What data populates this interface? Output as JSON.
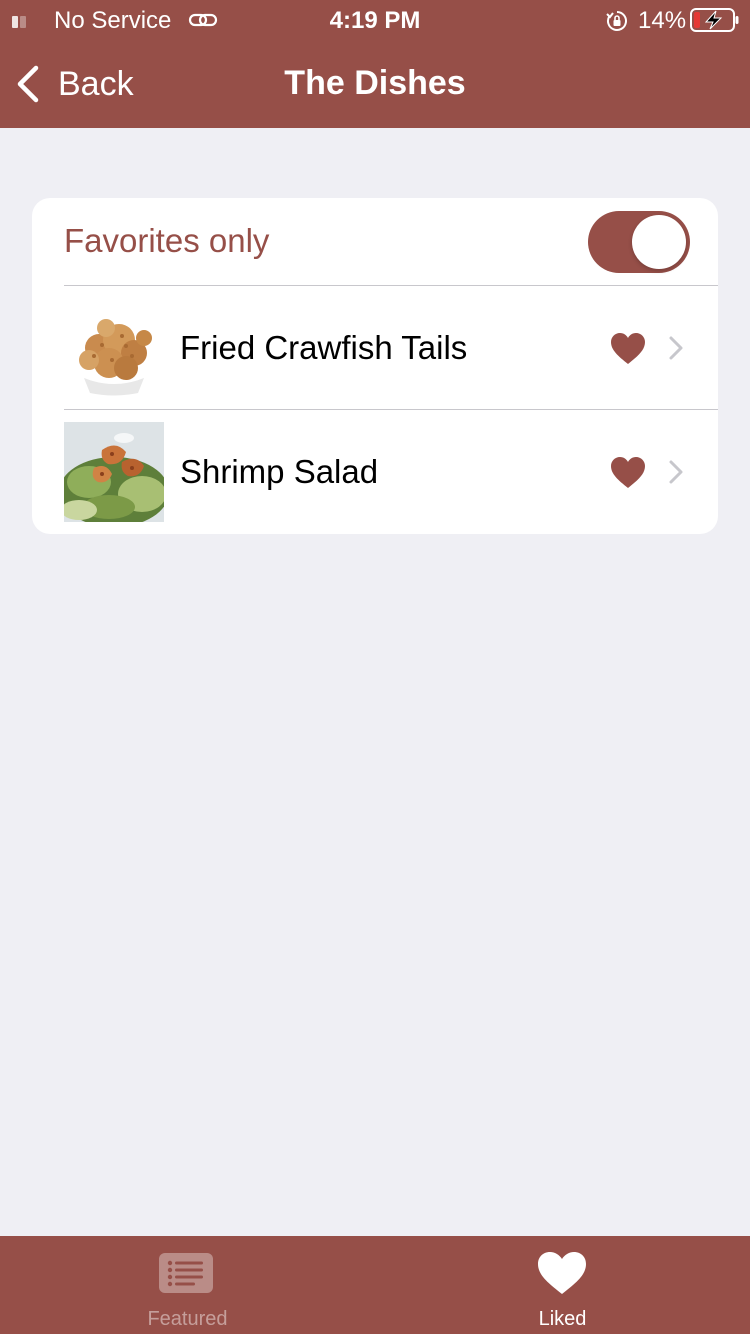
{
  "status_bar": {
    "carrier": "No Service",
    "time": "4:19 PM",
    "battery": "14%",
    "icons": [
      "signal-icon",
      "link-icon",
      "orientation-lock-icon",
      "battery-charging-icon"
    ]
  },
  "nav": {
    "back_label": "Back",
    "title": "The Dishes"
  },
  "filter": {
    "label": "Favorites only",
    "enabled": true
  },
  "dishes": [
    {
      "name": "Fried Crawfish Tails",
      "liked": true
    },
    {
      "name": "Shrimp Salad",
      "liked": true
    }
  ],
  "tabs": [
    {
      "label": "Featured",
      "icon": "list-icon",
      "selected": false
    },
    {
      "label": "Liked",
      "icon": "heart-icon",
      "selected": true
    }
  ],
  "colors": {
    "brand": "#964F48",
    "background": "#EFEFF4",
    "chevron": "#C7C7CC"
  }
}
